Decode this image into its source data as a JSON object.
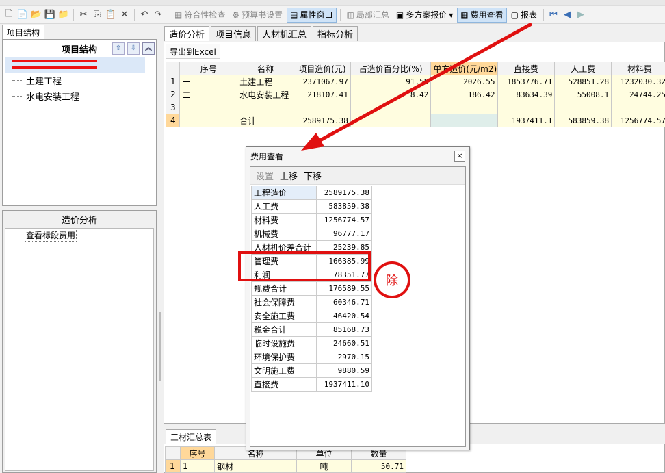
{
  "toolbar": {
    "buttons": {
      "compliance": "符合性检查",
      "budget_settings": "预算书设置",
      "property_window": "属性窗口",
      "partial_summary": "局部汇总",
      "multi_quote": "多方案报价",
      "fee_view": "费用查看",
      "report": "报表"
    }
  },
  "left": {
    "tab": "项目结构",
    "panel_title": "项目结构",
    "tree": [
      "土建工程",
      "水电安装工程"
    ],
    "cost_panel_title": "造价分析",
    "cost_tree": [
      "查看标段费用"
    ]
  },
  "tabs": [
    "造价分析",
    "项目信息",
    "人材机汇总",
    "指标分析"
  ],
  "export_button": "导出到Excel",
  "main_table": {
    "headers": [
      "序号",
      "名称",
      "项目造价(元)",
      "占造价百分比(%)",
      "单方造价(元/m2)",
      "直接费",
      "人工费",
      "材料费"
    ],
    "rows": [
      {
        "rn": "1",
        "seq": "一",
        "name": "土建工程",
        "cost": "2371067.97",
        "pct": "91.58",
        "unit": "2026.55",
        "direct": "1853776.71",
        "labor": "528851.28",
        "material": "1232030.32"
      },
      {
        "rn": "2",
        "seq": "二",
        "name": "水电安装工程",
        "cost": "218107.41",
        "pct": "8.42",
        "unit": "186.42",
        "direct": "83634.39",
        "labor": "55008.1",
        "material": "24744.25"
      },
      {
        "rn": "3",
        "seq": "",
        "name": "",
        "cost": "",
        "pct": "",
        "unit": "",
        "direct": "",
        "labor": "",
        "material": ""
      },
      {
        "rn": "4",
        "seq": "",
        "name": "合计",
        "cost": "2589175.38",
        "pct": "",
        "unit": "",
        "direct": "1937411.1",
        "labor": "583859.38",
        "material": "1256774.57"
      }
    ]
  },
  "dialog": {
    "title": "费用查看",
    "close": "×",
    "actions": [
      "设置",
      "上移",
      "下移"
    ],
    "rows": [
      {
        "k": "工程造价",
        "v": "2589175.38"
      },
      {
        "k": "人工费",
        "v": "583859.38"
      },
      {
        "k": "材料费",
        "v": "1256774.57"
      },
      {
        "k": "机械费",
        "v": "96777.17"
      },
      {
        "k": "人材机价差合计",
        "v": "25239.85"
      },
      {
        "k": "管理费",
        "v": "166385.99"
      },
      {
        "k": "利润",
        "v": "78351.77"
      },
      {
        "k": "规费合计",
        "v": "176589.55"
      },
      {
        "k": "社会保障费",
        "v": "60346.71"
      },
      {
        "k": "安全施工费",
        "v": "46420.54"
      },
      {
        "k": "税金合计",
        "v": "85168.73"
      },
      {
        "k": "临时设施费",
        "v": "24660.51"
      },
      {
        "k": "环境保护费",
        "v": "2970.15"
      },
      {
        "k": "文明施工费",
        "v": "9880.59"
      },
      {
        "k": "直接费",
        "v": "1937411.10"
      }
    ]
  },
  "annotation": {
    "text": "除"
  },
  "bottom": {
    "tab": "三材汇总表",
    "headers": [
      "序号",
      "名称",
      "单位",
      "数量"
    ],
    "row": {
      "rn": "1",
      "seq": "1",
      "name": "钢材",
      "unit": "吨",
      "qty": "50.71"
    }
  },
  "colors": {
    "highlight": "#ffd89a",
    "annotation_red": "#e01010",
    "selection": "#cfe3f7"
  }
}
